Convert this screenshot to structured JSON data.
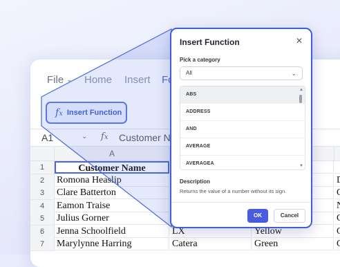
{
  "menu": {
    "file": "File",
    "home": "Home",
    "insert": "Insert",
    "formulas_partial": "Fo"
  },
  "toolbar": {
    "insert_function_label": "Insert Function"
  },
  "formula_bar": {
    "cell_ref": "A1",
    "formula": "Customer N"
  },
  "grid": {
    "column_a": "A",
    "rows": [
      {
        "num": "1",
        "a": "Customer Name",
        "b": "",
        "c": "",
        "d": ""
      },
      {
        "num": "2",
        "a": "Romona Heaslip",
        "b": "",
        "c": "",
        "d": "D"
      },
      {
        "num": "3",
        "a": "Clare Batterton",
        "b": "",
        "c": "",
        "d": "C"
      },
      {
        "num": "4",
        "a": "Eamon Traise",
        "b": "",
        "c": "",
        "d": "N"
      },
      {
        "num": "5",
        "a": "Julius Gorner",
        "b": "",
        "c": "",
        "d": "C"
      },
      {
        "num": "6",
        "a": "Jenna Schoolfield",
        "b": "LX",
        "c": "Yellow",
        "d": "C"
      },
      {
        "num": "7",
        "a": "Marylynne Harring",
        "b": "Catera",
        "c": "Green",
        "d": "C"
      }
    ]
  },
  "dialog": {
    "title": "Insert Function",
    "category_label": "Pick a category",
    "category_value": "All",
    "functions": [
      "ABS",
      "ADDRESS",
      "AND",
      "AVERAGE",
      "AVERAGEA"
    ],
    "description_label": "Description",
    "description_text": "Returns the value  of a number without its sign.",
    "ok": "OK",
    "cancel": "Cancel"
  },
  "colors": {
    "accent": "#4a5be0",
    "border_highlight": "#3f5fd8"
  }
}
